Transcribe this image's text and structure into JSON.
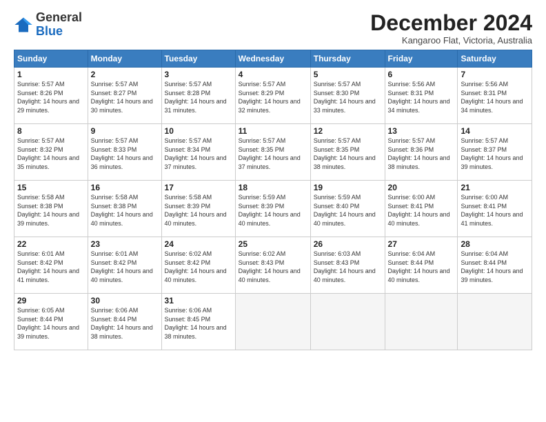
{
  "logo": {
    "general": "General",
    "blue": "Blue"
  },
  "header": {
    "month": "December 2024",
    "location": "Kangaroo Flat, Victoria, Australia"
  },
  "weekdays": [
    "Sunday",
    "Monday",
    "Tuesday",
    "Wednesday",
    "Thursday",
    "Friday",
    "Saturday"
  ],
  "weeks": [
    [
      {
        "day": 1,
        "info": "Sunrise: 5:57 AM\nSunset: 8:26 PM\nDaylight: 14 hours\nand 29 minutes."
      },
      {
        "day": 2,
        "info": "Sunrise: 5:57 AM\nSunset: 8:27 PM\nDaylight: 14 hours\nand 30 minutes."
      },
      {
        "day": 3,
        "info": "Sunrise: 5:57 AM\nSunset: 8:28 PM\nDaylight: 14 hours\nand 31 minutes."
      },
      {
        "day": 4,
        "info": "Sunrise: 5:57 AM\nSunset: 8:29 PM\nDaylight: 14 hours\nand 32 minutes."
      },
      {
        "day": 5,
        "info": "Sunrise: 5:57 AM\nSunset: 8:30 PM\nDaylight: 14 hours\nand 33 minutes."
      },
      {
        "day": 6,
        "info": "Sunrise: 5:56 AM\nSunset: 8:31 PM\nDaylight: 14 hours\nand 34 minutes."
      },
      {
        "day": 7,
        "info": "Sunrise: 5:56 AM\nSunset: 8:31 PM\nDaylight: 14 hours\nand 34 minutes."
      }
    ],
    [
      {
        "day": 8,
        "info": "Sunrise: 5:57 AM\nSunset: 8:32 PM\nDaylight: 14 hours\nand 35 minutes."
      },
      {
        "day": 9,
        "info": "Sunrise: 5:57 AM\nSunset: 8:33 PM\nDaylight: 14 hours\nand 36 minutes."
      },
      {
        "day": 10,
        "info": "Sunrise: 5:57 AM\nSunset: 8:34 PM\nDaylight: 14 hours\nand 37 minutes."
      },
      {
        "day": 11,
        "info": "Sunrise: 5:57 AM\nSunset: 8:35 PM\nDaylight: 14 hours\nand 37 minutes."
      },
      {
        "day": 12,
        "info": "Sunrise: 5:57 AM\nSunset: 8:35 PM\nDaylight: 14 hours\nand 38 minutes."
      },
      {
        "day": 13,
        "info": "Sunrise: 5:57 AM\nSunset: 8:36 PM\nDaylight: 14 hours\nand 38 minutes."
      },
      {
        "day": 14,
        "info": "Sunrise: 5:57 AM\nSunset: 8:37 PM\nDaylight: 14 hours\nand 39 minutes."
      }
    ],
    [
      {
        "day": 15,
        "info": "Sunrise: 5:58 AM\nSunset: 8:38 PM\nDaylight: 14 hours\nand 39 minutes."
      },
      {
        "day": 16,
        "info": "Sunrise: 5:58 AM\nSunset: 8:38 PM\nDaylight: 14 hours\nand 40 minutes."
      },
      {
        "day": 17,
        "info": "Sunrise: 5:58 AM\nSunset: 8:39 PM\nDaylight: 14 hours\nand 40 minutes."
      },
      {
        "day": 18,
        "info": "Sunrise: 5:59 AM\nSunset: 8:39 PM\nDaylight: 14 hours\nand 40 minutes."
      },
      {
        "day": 19,
        "info": "Sunrise: 5:59 AM\nSunset: 8:40 PM\nDaylight: 14 hours\nand 40 minutes."
      },
      {
        "day": 20,
        "info": "Sunrise: 6:00 AM\nSunset: 8:41 PM\nDaylight: 14 hours\nand 40 minutes."
      },
      {
        "day": 21,
        "info": "Sunrise: 6:00 AM\nSunset: 8:41 PM\nDaylight: 14 hours\nand 41 minutes."
      }
    ],
    [
      {
        "day": 22,
        "info": "Sunrise: 6:01 AM\nSunset: 8:42 PM\nDaylight: 14 hours\nand 41 minutes."
      },
      {
        "day": 23,
        "info": "Sunrise: 6:01 AM\nSunset: 8:42 PM\nDaylight: 14 hours\nand 40 minutes."
      },
      {
        "day": 24,
        "info": "Sunrise: 6:02 AM\nSunset: 8:42 PM\nDaylight: 14 hours\nand 40 minutes."
      },
      {
        "day": 25,
        "info": "Sunrise: 6:02 AM\nSunset: 8:43 PM\nDaylight: 14 hours\nand 40 minutes."
      },
      {
        "day": 26,
        "info": "Sunrise: 6:03 AM\nSunset: 8:43 PM\nDaylight: 14 hours\nand 40 minutes."
      },
      {
        "day": 27,
        "info": "Sunrise: 6:04 AM\nSunset: 8:44 PM\nDaylight: 14 hours\nand 40 minutes."
      },
      {
        "day": 28,
        "info": "Sunrise: 6:04 AM\nSunset: 8:44 PM\nDaylight: 14 hours\nand 39 minutes."
      }
    ],
    [
      {
        "day": 29,
        "info": "Sunrise: 6:05 AM\nSunset: 8:44 PM\nDaylight: 14 hours\nand 39 minutes."
      },
      {
        "day": 30,
        "info": "Sunrise: 6:06 AM\nSunset: 8:44 PM\nDaylight: 14 hours\nand 38 minutes."
      },
      {
        "day": 31,
        "info": "Sunrise: 6:06 AM\nSunset: 8:45 PM\nDaylight: 14 hours\nand 38 minutes."
      },
      null,
      null,
      null,
      null
    ]
  ]
}
